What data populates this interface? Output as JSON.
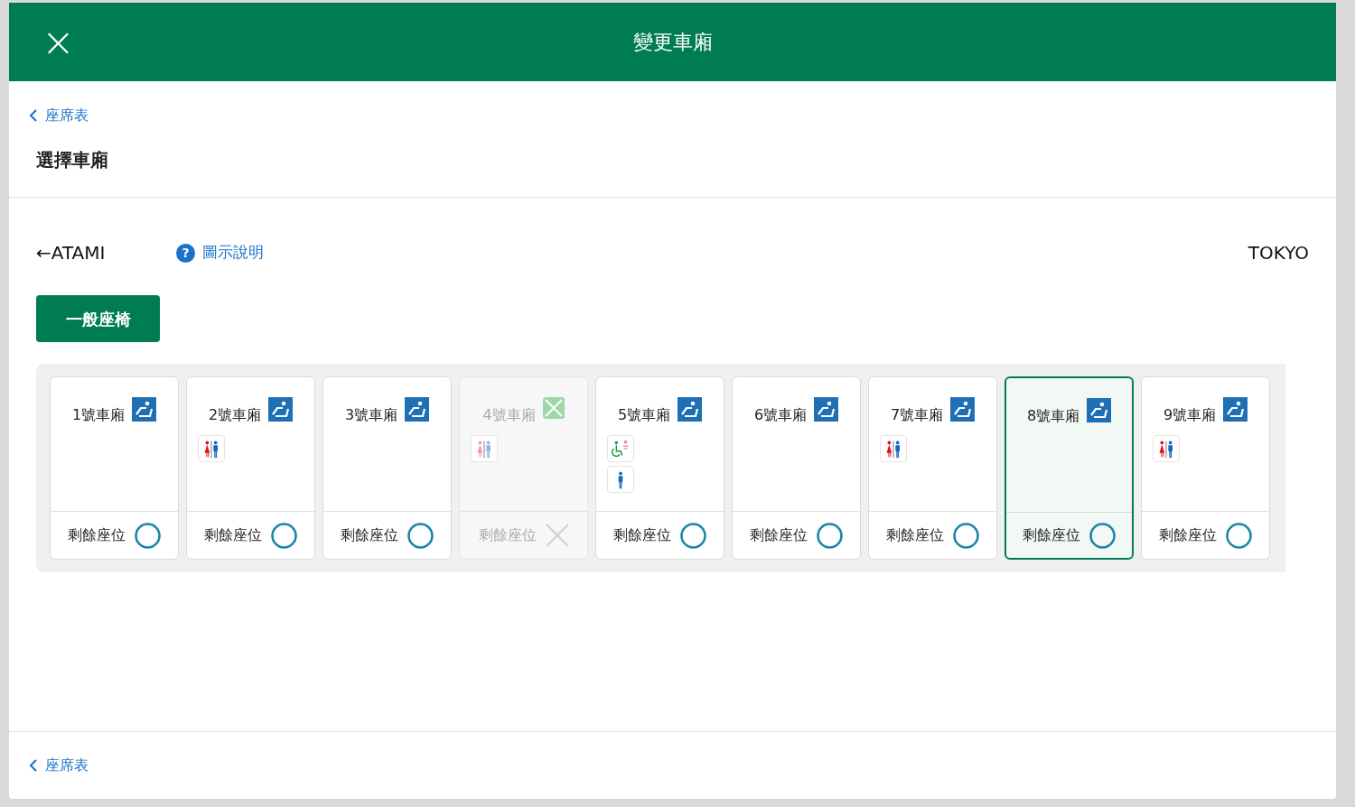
{
  "header": {
    "close": "×",
    "title": "變更車廂"
  },
  "back_link": "座席表",
  "heading": "選擇車廂",
  "route": {
    "from": "←ATAMI",
    "to": "TOKYO",
    "help_mark": "?",
    "legend_link": "圖示說明"
  },
  "class_tab": {
    "label": "一般座椅",
    "selected": true
  },
  "cars": [
    {
      "name": "1號車廂",
      "selected": false,
      "disabled": false,
      "seats_label": "剩餘座位",
      "available": true
    },
    {
      "name": "2號車廂",
      "selected": false,
      "disabled": false,
      "facilities": [
        {
          "kind": "restroom"
        }
      ],
      "seats_label": "剩餘座位",
      "available": true
    },
    {
      "name": "3號車廂",
      "selected": false,
      "disabled": false,
      "seats_label": "剩餘座位",
      "available": true
    },
    {
      "name": "4號車廂",
      "selected": false,
      "disabled": true,
      "facilities": [
        {
          "kind": "restroom"
        }
      ],
      "seats_label": "剩餘座位",
      "available": false
    },
    {
      "name": "5號車廂",
      "selected": false,
      "disabled": false,
      "facilities": [
        {
          "kind": "accessible"
        },
        {
          "kind": "mens"
        }
      ],
      "seats_label": "剩餘座位",
      "available": true
    },
    {
      "name": "6號車廂",
      "selected": false,
      "disabled": false,
      "seats_label": "剩餘座位",
      "available": true
    },
    {
      "name": "7號車廂",
      "selected": false,
      "disabled": false,
      "facilities": [
        {
          "kind": "restroom"
        }
      ],
      "seats_label": "剩餘座位",
      "available": true
    },
    {
      "name": "8號車廂",
      "selected": true,
      "disabled": false,
      "seats_label": "剩餘座位",
      "available": true
    },
    {
      "name": "9號車廂",
      "selected": false,
      "disabled": false,
      "facilities": [
        {
          "kind": "restroom"
        }
      ],
      "seats_label": "剩餘座位",
      "available": true
    }
  ],
  "footer_link": "座席表"
}
